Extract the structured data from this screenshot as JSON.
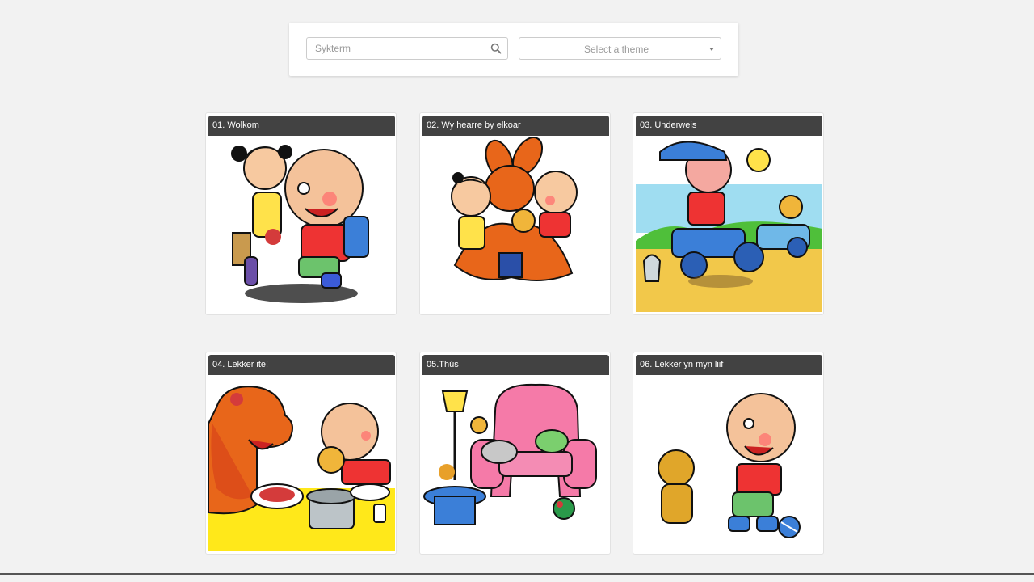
{
  "search": {
    "placeholder": "Sykterm",
    "icon": "search-icon"
  },
  "theme_select": {
    "selected": "Select a theme",
    "icon": "caret-down-icon"
  },
  "cards": [
    {
      "title": "01. Wolkom",
      "image": "two-cartoon-kids-walking-illustration"
    },
    {
      "title": "02. Wy hearre by elkoar",
      "image": "kangaroo-with-kids-and-bear-illustration"
    },
    {
      "title": "03. Underweis",
      "image": "baby-on-toy-tractor-illustration"
    },
    {
      "title": "04. Lekker ite!",
      "image": "kangaroo-and-baby-eating-illustration"
    },
    {
      "title": "05.Thús",
      "image": "pink-armchair-living-room-illustration"
    },
    {
      "title": "06. Lekker yn myn liif",
      "image": "baby-and-bear-playing-ball-illustration"
    }
  ]
}
